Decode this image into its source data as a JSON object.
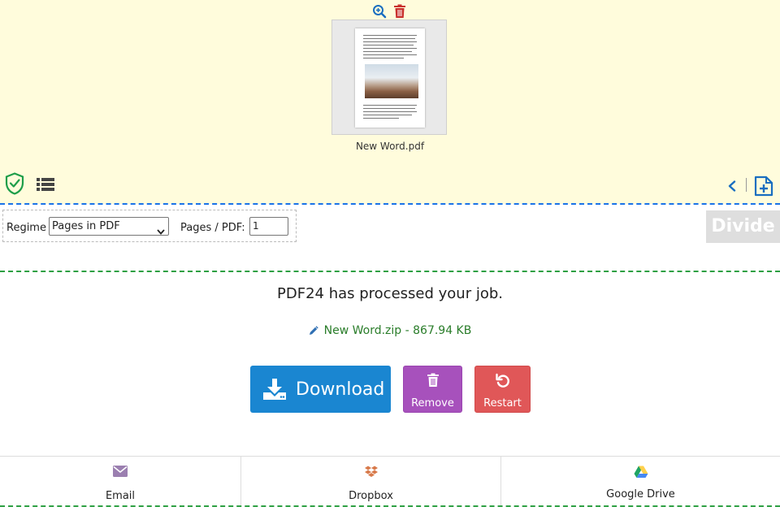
{
  "file": {
    "name": "New Word.pdf"
  },
  "options": {
    "regime_label": "Regime",
    "regime_value": "Pages in PDF",
    "pages_label": "Pages / PDF:",
    "pages_value": "1",
    "divide_label": "Divide"
  },
  "result": {
    "message": "PDF24 has processed your job.",
    "file_label": "New Word.zip - 867.94 KB"
  },
  "actions": {
    "download": "Download",
    "remove": "Remove",
    "restart": "Restart"
  },
  "share": [
    {
      "label": "Email",
      "icon": "email-icon"
    },
    {
      "label": "Dropbox",
      "icon": "dropbox-icon"
    },
    {
      "label": "Google Drive",
      "icon": "google-drive-icon"
    }
  ],
  "colors": {
    "top_background": "#fffcdc",
    "download": "#1a86d1",
    "remove": "#a751bc",
    "restart": "#e05758",
    "result_text": "#2a7d2a"
  }
}
